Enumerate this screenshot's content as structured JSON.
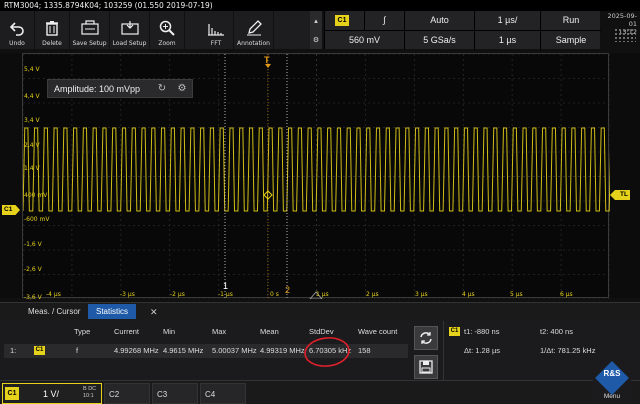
{
  "title_line": "RTM3004; 1335.8794K04; 103259 (01.550 2019-07-19)",
  "toolbar": [
    {
      "label": "Undo",
      "icon": "undo-icon"
    },
    {
      "label": "Delete",
      "icon": "trash-icon"
    },
    {
      "label": "Save Setup",
      "icon": "save-setup-icon"
    },
    {
      "label": "Load Setup",
      "icon": "load-setup-icon"
    },
    {
      "label": "Zoom",
      "icon": "zoom-icon"
    },
    {
      "label": "FFT",
      "icon": "fft-icon"
    },
    {
      "label": "Annotation",
      "icon": "annotation-icon"
    }
  ],
  "acquisition": {
    "channel": "C1",
    "slope": "∫",
    "trigger_mode": "Auto",
    "timebase": "1 µs/",
    "run_state": "Run",
    "trigger_level": "560 mV",
    "sample_rate": "5 GSa/s",
    "record_time": "1 µs",
    "acq_mode": "Sample"
  },
  "datetime": {
    "date": "2025-09-01",
    "time": "13:12"
  },
  "screen": {
    "y_labels": [
      "5,4 V",
      "4,4 V",
      "3,4 V",
      "2,4 V",
      "1,4 V",
      "400 mV",
      "-600 mV",
      "-1,6 V",
      "-2,6 V",
      "-3,6 V"
    ],
    "x_labels": [
      "-4 µs",
      "-3 µs",
      "-2 µs",
      "-1 µs",
      "0 s",
      "1 µs",
      "2 µs",
      "3 µs",
      "4 µs",
      "5 µs",
      "6 µs"
    ],
    "channel_marker": "C1",
    "trigger_level_marker": "TL",
    "trigger_pos_marker": "T",
    "cursor1_label": "1",
    "cursor2_label": "2",
    "signal_color": "#e6d21a",
    "amplitude_box": "Amplitude: 100 mVpp"
  },
  "results": {
    "tabs": [
      "Meas. / Cursor",
      "Statistics"
    ],
    "active_tab": "Statistics",
    "close_glyph": "✕",
    "headers": [
      "Type",
      "Current",
      "Min",
      "Max",
      "Mean",
      "StdDev",
      "Wave count"
    ],
    "row": {
      "index": "1:",
      "channel": "C1",
      "type": "f",
      "current": "4.99268 MHz",
      "min": "4.9615 MHz",
      "max": "5.00037 MHz",
      "mean": "4.99319 MHz",
      "stddev": "6.70305 kHz",
      "wave_count": "158"
    },
    "highlight_color": "#e0202a"
  },
  "cursor_info": {
    "channel": "C1",
    "t1": "t1: -880 ns",
    "t2": "t2: 400 ns",
    "dt": "Δt: 1.28 µs",
    "inv_dt": "1/Δt: 781.25 kHz"
  },
  "bottom": {
    "c1_tag": "C1",
    "c1_scale": "1 V/",
    "c1_coupling": "B DC",
    "c1_extra": "10:1",
    "channels": [
      "C2",
      "C3",
      "C4"
    ],
    "menu_label": "Menu"
  }
}
